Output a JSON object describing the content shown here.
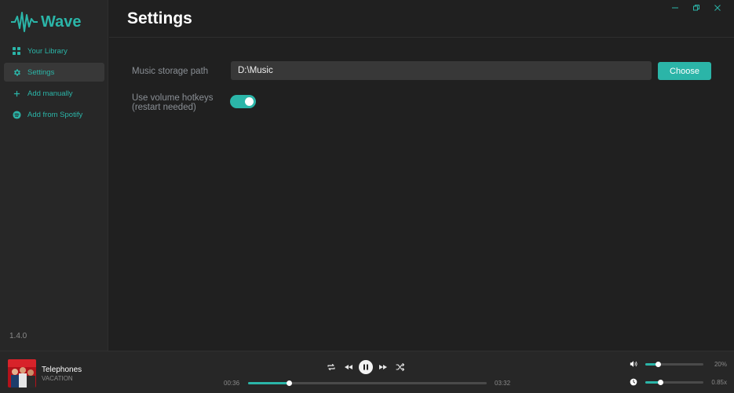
{
  "app": {
    "name": "Wave",
    "version": "1.4.0"
  },
  "sidebar": {
    "items": [
      {
        "label": "Your Library",
        "icon": "grid-icon",
        "active": false
      },
      {
        "label": "Settings",
        "icon": "gear-icon",
        "active": true
      },
      {
        "label": "Add manually",
        "icon": "plus-icon",
        "active": false
      },
      {
        "label": "Add from Spotify",
        "icon": "spotify-icon",
        "active": false
      }
    ]
  },
  "window_controls": [
    "minimize-icon",
    "restore-icon",
    "close-icon"
  ],
  "settings": {
    "title": "Settings",
    "storage_label": "Music storage path",
    "storage_value": "D:\\Music",
    "choose_label": "Choose",
    "hotkeys_label_line1": "Use volume hotkeys",
    "hotkeys_label_line2": "(restart needed)",
    "hotkeys_enabled": true
  },
  "player": {
    "title": "Telephones",
    "artist": "VACATION",
    "elapsed": "00:36",
    "duration": "03:32",
    "progress": 0.17,
    "volume_label": "20%",
    "volume": 0.22,
    "speed_label": "0.85x",
    "speed": 0.26
  },
  "colors": {
    "accent": "#2bb5a8",
    "background": "#202020",
    "sidebar": "#272727"
  }
}
